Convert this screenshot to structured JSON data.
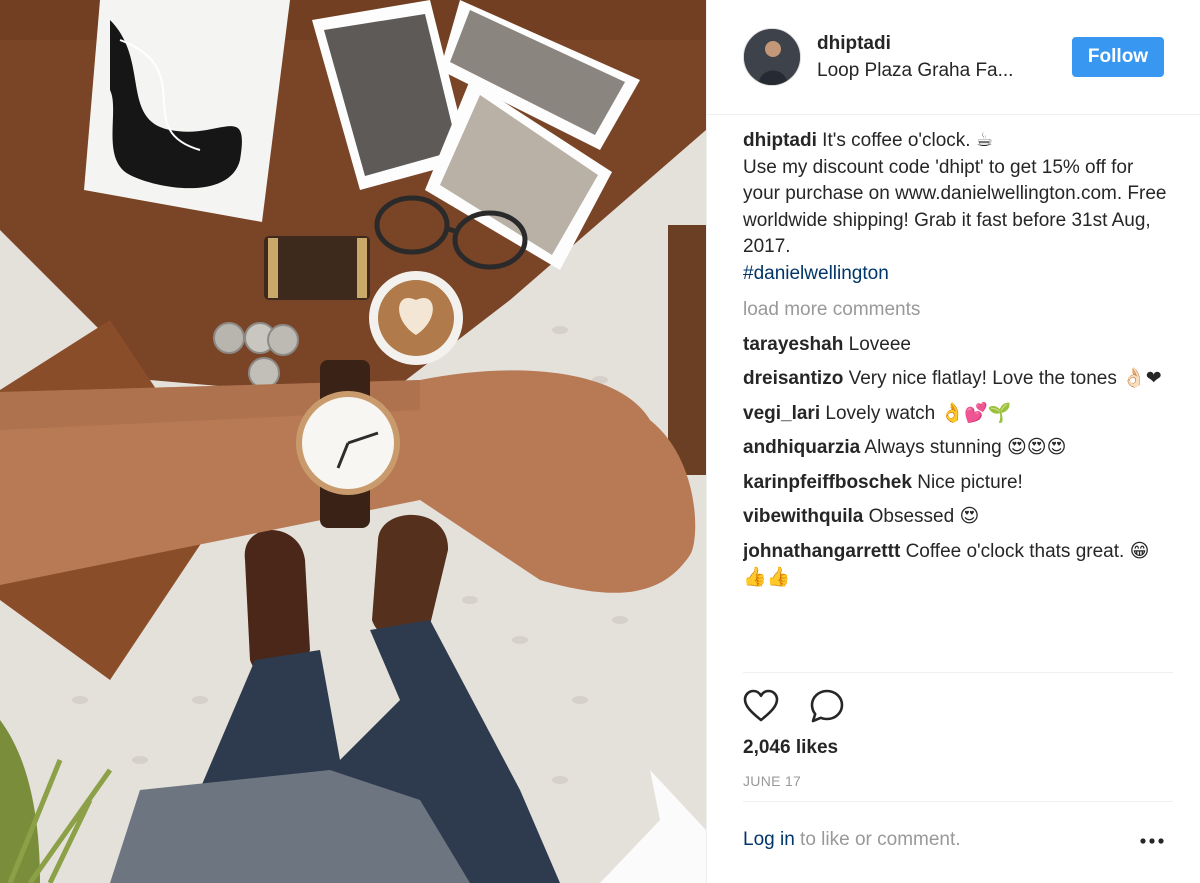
{
  "post": {
    "username": "dhiptadi",
    "location": "Loop Plaza Graha Fa...",
    "follow_label": "Follow",
    "caption_user": "dhiptadi",
    "caption_text": "It's coffee o'clock. ☕\nUse my discount code 'dhipt' to get 15% off for your purchase on www.danielwellington.com. Free worldwide shipping! Grab it fast before 31st Aug, 2017.",
    "hashtag": "#danielwellington",
    "load_more": "load more comments",
    "comments": [
      {
        "user": "tarayeshah",
        "text": "Loveee"
      },
      {
        "user": "dreisantizo",
        "text": "Very nice flatlay! Love the tones 👌🏻❤"
      },
      {
        "user": "vegi_lari",
        "text": "Lovely watch 👌💕🌱"
      },
      {
        "user": "andhiquarzia",
        "text": "Always stunning 😍😍😍"
      },
      {
        "user": "karinpfeiffboschek",
        "text": "Nice picture!"
      },
      {
        "user": "vibewithquila",
        "text": "Obsessed 😍"
      },
      {
        "user": "johnathangarrettt",
        "text": "Coffee o'clock thats great. 😁👍👍"
      }
    ],
    "likes": "2,046 likes",
    "date": "JUNE 17",
    "login_label": "Log in",
    "login_suffix": " to like or comment.",
    "icons": {
      "like": "heart-icon",
      "comment": "speech-bubble-icon",
      "more": "ellipsis-icon"
    },
    "colors": {
      "follow_button": "#3897f0",
      "link": "#003569",
      "muted": "#999999"
    }
  }
}
